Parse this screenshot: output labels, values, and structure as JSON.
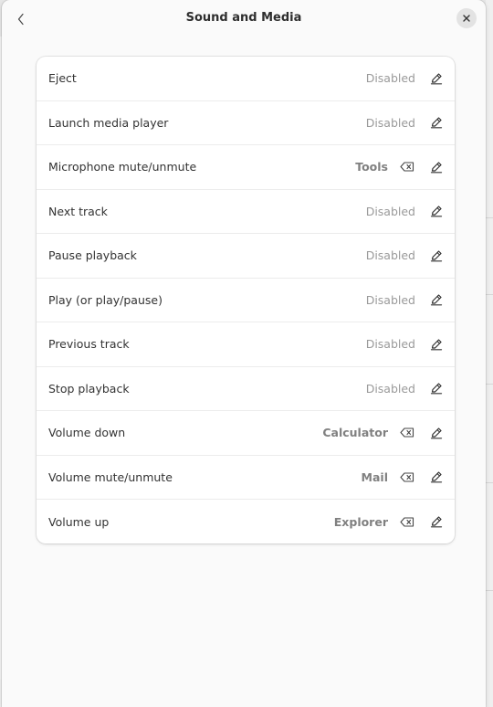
{
  "dialog": {
    "title": "Sound and Media",
    "back_icon": "chevron-left-icon",
    "close_icon": "close-icon"
  },
  "shortcuts": [
    {
      "label": "Eject",
      "value": "Disabled",
      "assigned": false
    },
    {
      "label": "Launch media player",
      "value": "Disabled",
      "assigned": false
    },
    {
      "label": "Microphone mute/unmute",
      "value": "Tools",
      "assigned": true
    },
    {
      "label": "Next track",
      "value": "Disabled",
      "assigned": false
    },
    {
      "label": "Pause playback",
      "value": "Disabled",
      "assigned": false
    },
    {
      "label": "Play (or play/pause)",
      "value": "Disabled",
      "assigned": false
    },
    {
      "label": "Previous track",
      "value": "Disabled",
      "assigned": false
    },
    {
      "label": "Stop playback",
      "value": "Disabled",
      "assigned": false
    },
    {
      "label": "Volume down",
      "value": "Calculator",
      "assigned": true
    },
    {
      "label": "Volume mute/unmute",
      "value": "Mail",
      "assigned": true
    },
    {
      "label": "Volume up",
      "value": "Explorer",
      "assigned": true
    }
  ],
  "icons": {
    "edit": "pencil-edit-icon",
    "clear": "backspace-clear-icon"
  },
  "colors": {
    "dialog_bg": "#fafafa",
    "card_bg": "#ffffff",
    "muted_text": "#9a9a9a",
    "assigned_text": "#808080"
  }
}
